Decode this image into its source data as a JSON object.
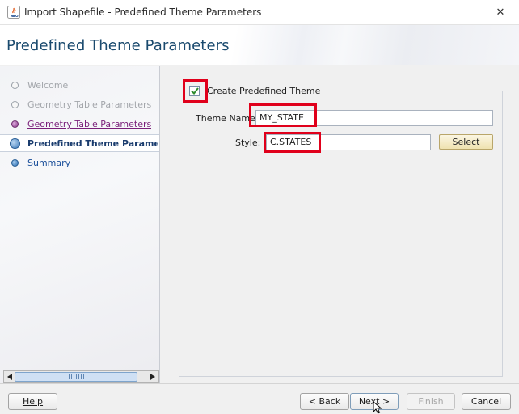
{
  "window": {
    "title": "Import Shapefile - Predefined Theme Parameters",
    "close_symbol": "✕"
  },
  "header": {
    "page_title": "Predefined Theme Parameters"
  },
  "steps": [
    {
      "label": "Welcome",
      "state": "disabled"
    },
    {
      "label": "Geometry Table Parameters",
      "state": "disabled"
    },
    {
      "label": "Geometry Table Parameters",
      "state": "visited"
    },
    {
      "label": "Predefined Theme Parameters",
      "state": "current"
    },
    {
      "label": "Summary",
      "state": "link"
    }
  ],
  "form": {
    "group_title": "Create Predefined Theme",
    "create_checked": true,
    "theme_name_label": "Theme Name:",
    "theme_name_value": "MY_STATE",
    "style_label": "Style:",
    "style_value": "C.STATES",
    "select_label": "Select"
  },
  "footer": {
    "help_label": "Help",
    "back_label": "< Back",
    "next_label": "Next >",
    "finish_label": "Finish",
    "cancel_label": "Cancel"
  },
  "colors": {
    "highlight": "#e0001b",
    "title_blue": "#1a4a6e",
    "visited_purple": "#7a1f7a",
    "link_blue": "#1b4f9a"
  }
}
